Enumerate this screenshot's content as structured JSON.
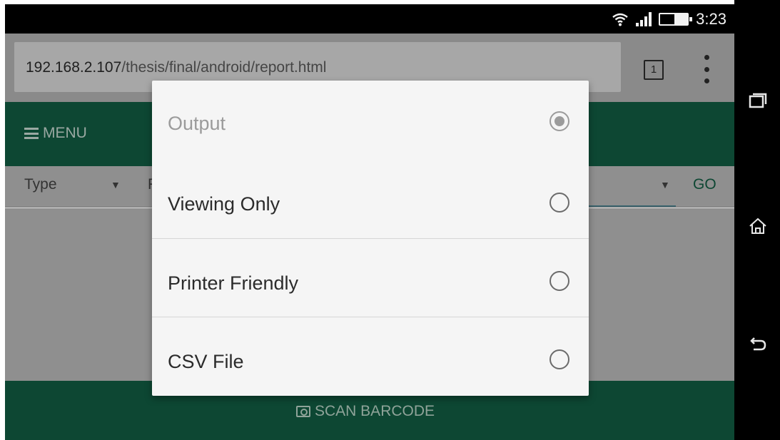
{
  "status": {
    "time": "3:23",
    "icons": [
      "wifi-icon",
      "signal-icon",
      "battery-icon"
    ]
  },
  "browser": {
    "url_host": "192.168.2.107",
    "url_path": "/thesis/final/android/report.html",
    "tab_count": "1"
  },
  "page": {
    "menu_label": "MENU",
    "type_label": "Type",
    "second_label": "F",
    "go_label": "GO",
    "scan_label": "SCAN BARCODE",
    "header_color": "#0d4733"
  },
  "dialog": {
    "title": "Output",
    "options": [
      {
        "label": "Viewing Only",
        "selected": false
      },
      {
        "label": "Printer Friendly",
        "selected": false
      },
      {
        "label": "CSV File",
        "selected": false
      }
    ]
  },
  "navbar": {
    "icons": [
      "recent-apps-icon",
      "home-icon",
      "back-icon"
    ]
  }
}
